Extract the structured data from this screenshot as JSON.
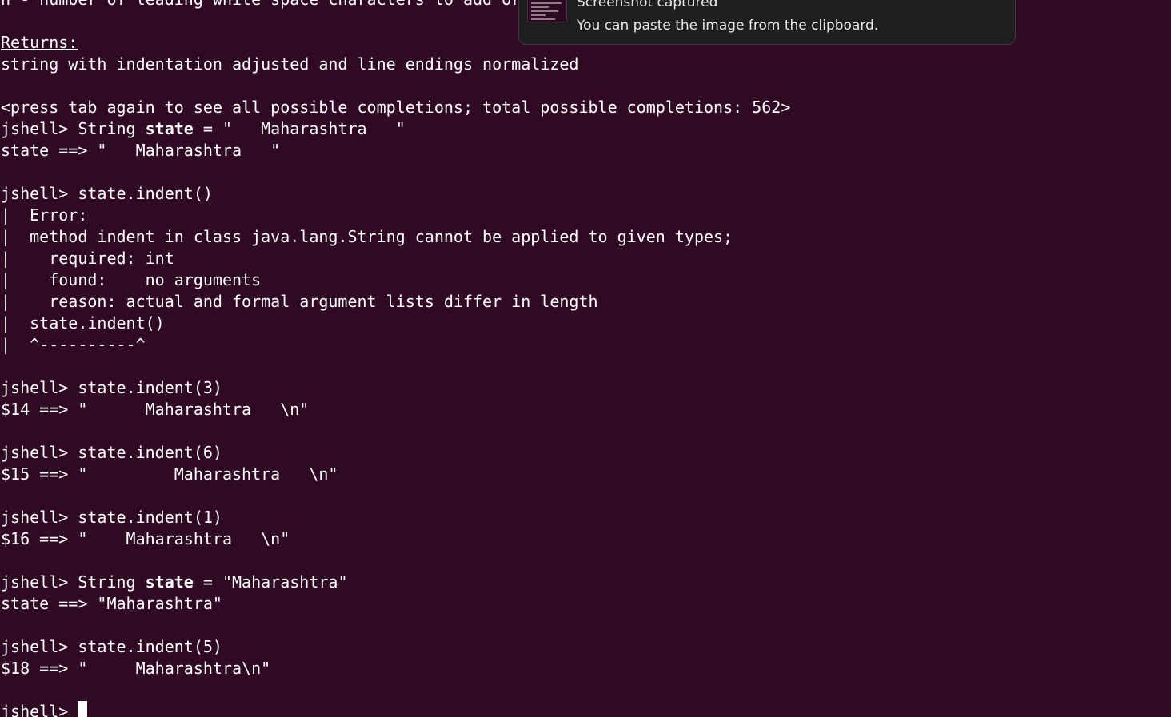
{
  "terminal": {
    "lines": [
      "n - number of leading white space characters to add or",
      "",
      "Returns:",
      "string with indentation adjusted and line endings normalized",
      "",
      "<press tab again to see all possible completions; total possible completions: 562>",
      "jshell> String state = \"   Maharashtra   \"",
      "state ==> \"   Maharashtra   \"",
      "",
      "jshell> state.indent()",
      "|  Error:",
      "|  method indent in class java.lang.String cannot be applied to given types;",
      "|    required: int",
      "|    found:    no arguments",
      "|    reason: actual and formal argument lists differ in length",
      "|  state.indent()",
      "|  ^----------^",
      "",
      "jshell> state.indent(3)",
      "$14 ==> \"      Maharashtra   \\n\"",
      "",
      "jshell> state.indent(6)",
      "$15 ==> \"         Maharashtra   \\n\"",
      "",
      "jshell> state.indent(1)",
      "$16 ==> \"    Maharashtra   \\n\"",
      "",
      "jshell> String state = \"Maharashtra\"",
      "state ==> \"Maharashtra\"",
      "",
      "jshell> state.indent(5)",
      "$18 ==> \"     Maharashtra\\n\"",
      "",
      "jshell> "
    ],
    "bold_words": {
      "6": "state",
      "27": "state"
    },
    "colors": {
      "background": "#300a24",
      "foreground": "#ffffff"
    }
  },
  "notification": {
    "title": "Screenshot captured",
    "body": "You can paste the image from the clipboard.",
    "icon": "screenshot-thumbnail-icon"
  }
}
